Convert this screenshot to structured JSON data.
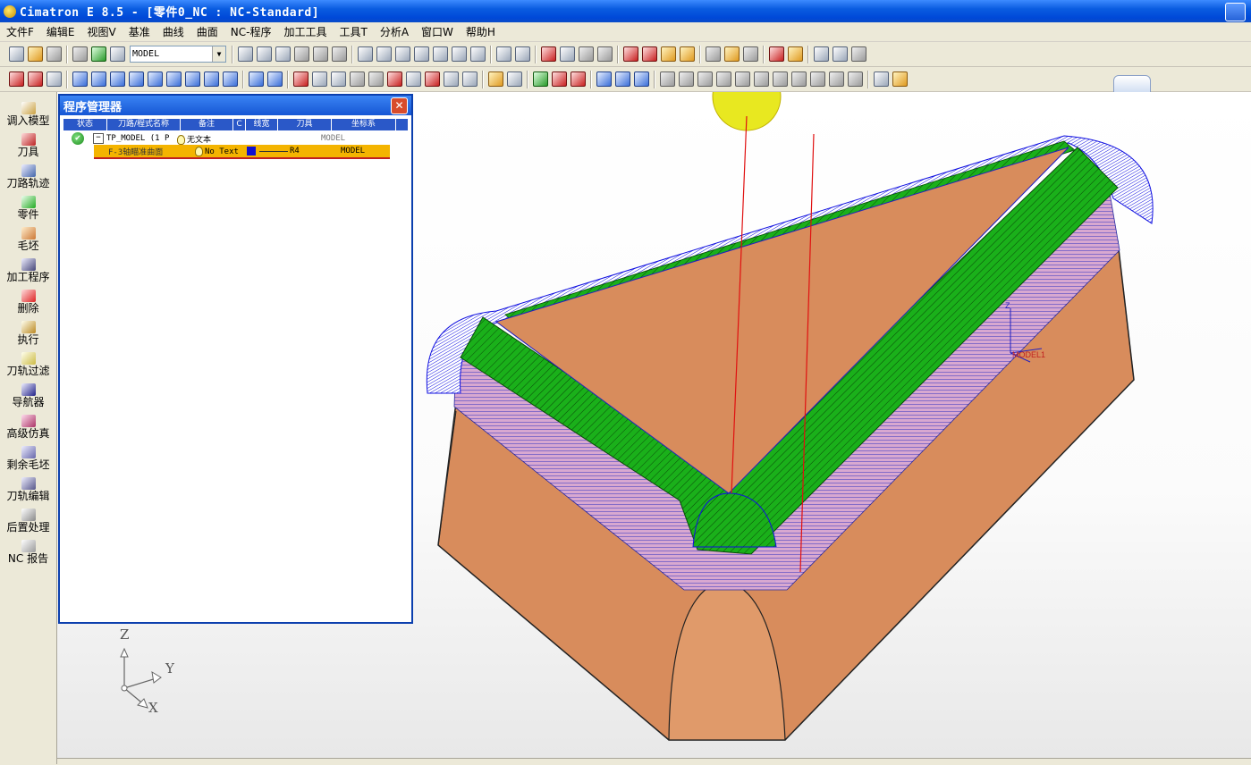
{
  "window": {
    "title": "Cimatron E 8.5 - [零件0_NC : NC-Standard]"
  },
  "menu": [
    "文件F",
    "编辑E",
    "视图V",
    "基准",
    "曲线",
    "曲面",
    "NC-程序",
    "加工工具",
    "工具T",
    "分析A",
    "窗口W",
    "帮助H"
  ],
  "toolbar": {
    "model_select": "MODEL"
  },
  "left_panel": [
    {
      "label": "调入模型",
      "icon": "load-model-icon"
    },
    {
      "label": "刀具",
      "icon": "tool-icon"
    },
    {
      "label": "刀路轨迹",
      "icon": "toolpath-icon"
    },
    {
      "label": "零件",
      "icon": "part-icon"
    },
    {
      "label": "毛坯",
      "icon": "stock-icon"
    },
    {
      "label": "加工程序",
      "icon": "procedure-icon"
    },
    {
      "label": "删除",
      "icon": "delete-icon"
    },
    {
      "label": "执行",
      "icon": "execute-icon"
    },
    {
      "label": "刀轨过滤",
      "icon": "filter-icon"
    },
    {
      "label": "导航器",
      "icon": "navigator-icon"
    },
    {
      "label": "高级仿真",
      "icon": "simulation-icon"
    },
    {
      "label": "剩余毛坯",
      "icon": "remaining-stock-icon"
    },
    {
      "label": "刀轨编辑",
      "icon": "edit-toolpath-icon"
    },
    {
      "label": "后置处理",
      "icon": "post-process-icon"
    },
    {
      "label": "NC 报告",
      "icon": "nc-report-icon"
    }
  ],
  "program_manager": {
    "title": "程序管理器",
    "columns": [
      "状态",
      "刀路/程式名称",
      "备注",
      "C",
      "线宽",
      "刀具",
      "坐标系"
    ],
    "rows": [
      {
        "name": "TP_MODEL (1 P",
        "note": "无文本",
        "tool": "",
        "coord": "MODEL"
      },
      {
        "name": "F-3轴瞄准曲面",
        "note": "No Text",
        "tool": "R4",
        "coord": "MODEL"
      }
    ]
  },
  "viewport": {
    "triad": {
      "z": "Z",
      "y": "Y",
      "x": "X"
    },
    "ucs_label": "MODEL1",
    "colors": {
      "part": "#d88c5c",
      "toolpath_green": "#1aa81a",
      "toolpath_blue": "#1010e0",
      "toolpath_pink": "#c896c8",
      "tool_line": "#e01010"
    }
  }
}
